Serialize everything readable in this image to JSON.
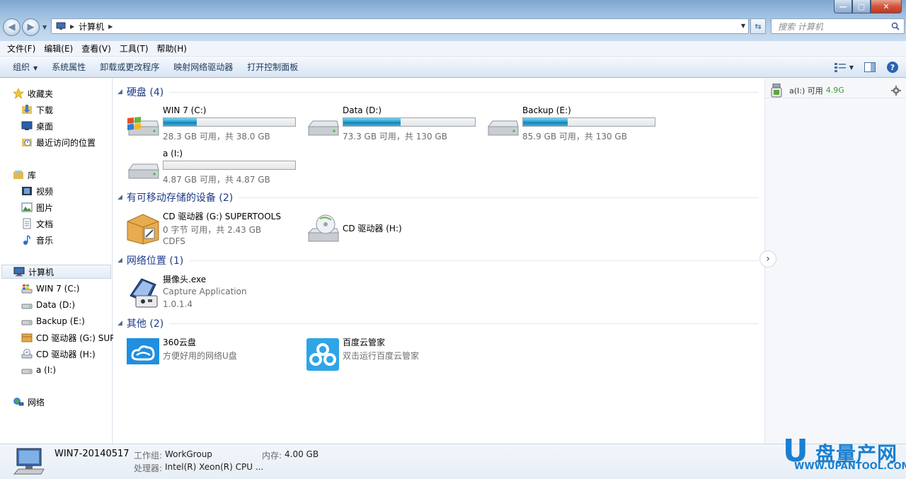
{
  "window": {
    "minimize": "—",
    "maximize": "▢",
    "close": "✕"
  },
  "address": {
    "location": "计算机",
    "search_placeholder": "搜索 计算机"
  },
  "menu": [
    "文件(F)",
    "编辑(E)",
    "查看(V)",
    "工具(T)",
    "帮助(H)"
  ],
  "toolbar": {
    "organize": "组织",
    "system_properties": "系统属性",
    "uninstall": "卸载或更改程序",
    "map_drive": "映射网络驱动器",
    "control_panel": "打开控制面板"
  },
  "nav": {
    "favorites": "收藏夹",
    "downloads": "下载",
    "desktop": "桌面",
    "recent": "最近访问的位置",
    "libraries": "库",
    "videos": "视频",
    "pictures": "图片",
    "documents": "文档",
    "music": "音乐",
    "computer": "计算机",
    "drive_c": "WIN 7 (C:)",
    "drive_d": "Data (D:)",
    "drive_e": "Backup (E:)",
    "drive_g": "CD 驱动器 (G:) SUPERTOOLS",
    "drive_h": "CD 驱动器 (H:)",
    "drive_i": "a (I:)",
    "network": "网络"
  },
  "groups": {
    "hdd": "硬盘 (4)",
    "removable": "有可移动存储的设备 (2)",
    "network": "网络位置 (1)",
    "other": "其他 (2)"
  },
  "drives": {
    "c": {
      "name": "WIN 7 (C:)",
      "free": "28.3 GB 可用，共 38.0 GB",
      "used_fraction": 0.255
    },
    "d": {
      "name": "Data (D:)",
      "free": "73.3 GB 可用，共 130 GB",
      "used_fraction": 0.436
    },
    "e": {
      "name": "Backup (E:)",
      "free": "85.9 GB 可用，共 130 GB",
      "used_fraction": 0.339
    },
    "i": {
      "name": "a (I:)",
      "free": "4.87 GB 可用，共 4.87 GB",
      "used_fraction": 0.0
    }
  },
  "removable": {
    "g": {
      "name": "CD 驱动器 (G:) SUPERTOOLS",
      "free": "0 字节 可用，共 2.43 GB",
      "fs": "CDFS"
    },
    "h": {
      "name": "CD 驱动器 (H:)"
    }
  },
  "network_items": {
    "camera": {
      "name": "摄像头.exe",
      "desc": "Capture Application",
      "version": "1.0.1.4"
    }
  },
  "other_items": {
    "yun360": {
      "name": "360云盘",
      "desc": "方便好用的网络U盘"
    },
    "baidu": {
      "name": "百度云管家",
      "desc": "双击运行百度云管家"
    }
  },
  "gadget": {
    "label": "a(I:) 可用",
    "value": "4.9G"
  },
  "details": {
    "computer_name": "WIN7-20140517",
    "workgroup_label": "工作组:",
    "workgroup": "WorkGroup",
    "memory_label": "内存:",
    "memory": "4.00 GB",
    "cpu_label": "处理器:",
    "cpu": "Intel(R) Xeon(R) CPU ..."
  },
  "watermark": {
    "letter": "U",
    "text": "盘量产网",
    "url": "WWW.UPANTOOL.COM"
  },
  "colors": {
    "accent": "#1e3a8a",
    "bar_fill": "#28a6d2",
    "watermark": "#1a7fd0"
  }
}
